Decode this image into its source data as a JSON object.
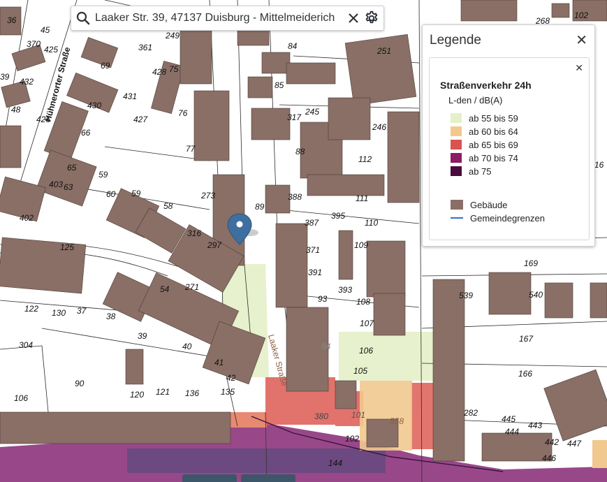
{
  "search": {
    "value": "Laaker Str. 39, 47137 Duisburg - Mittelmeiderich",
    "icon_search": "search-icon",
    "icon_clear": "close-icon",
    "icon_settings": "gear-icon"
  },
  "legend": {
    "title": "Legende",
    "layer_title": "Straßenverkehr 24h",
    "unit": "L-den / dB(A)",
    "items": [
      {
        "label": "ab 55 bis 59",
        "color": "#e3f1c8"
      },
      {
        "label": "ab 60 bis 64",
        "color": "#f2c98e"
      },
      {
        "label": "ab 65 bis 69",
        "color": "#d9534f"
      },
      {
        "label": "ab 70 bis 74",
        "color": "#8e1a63"
      },
      {
        "label": "ab 75",
        "color": "#4a0a3e"
      }
    ],
    "buildings_label": "Gebäude",
    "buildings_color": "#8a6f66",
    "boundaries_label": "Gemeindegrenzen",
    "boundaries_color": "#2f6fd0"
  },
  "map": {
    "streets": [
      "Hühnerorter Straße",
      "Laaker Straße"
    ],
    "house_numbers": [
      "36",
      "45",
      "370",
      "425",
      "39",
      "432",
      "48",
      "426",
      "430",
      "431",
      "427",
      "66",
      "65",
      "59",
      "63",
      "403",
      "60",
      "59",
      "58",
      "402",
      "125",
      "428",
      "76",
      "77",
      "69",
      "361",
      "249",
      "273",
      "316",
      "297",
      "89",
      "84",
      "85",
      "317",
      "245",
      "246",
      "88",
      "388",
      "112",
      "111",
      "395",
      "387",
      "110",
      "371",
      "109",
      "391",
      "393",
      "93",
      "108",
      "107",
      "106",
      "105",
      "94",
      "101",
      "380",
      "102",
      "144",
      "558",
      "54",
      "271",
      "122",
      "130",
      "37",
      "38",
      "39",
      "40",
      "41",
      "42",
      "135",
      "136",
      "121",
      "120",
      "106",
      "90",
      "304",
      "251",
      "169",
      "539",
      "540",
      "167",
      "166",
      "282",
      "445",
      "444",
      "443",
      "442",
      "447",
      "446",
      "268",
      "102",
      "16",
      "75"
    ]
  }
}
